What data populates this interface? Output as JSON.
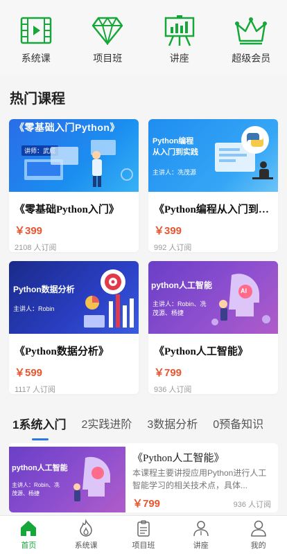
{
  "categories": [
    {
      "label": "系统课",
      "icon": "film-icon"
    },
    {
      "label": "项目班",
      "icon": "diamond-icon"
    },
    {
      "label": "讲座",
      "icon": "easel-icon"
    },
    {
      "label": "超级会员",
      "icon": "crown-icon"
    }
  ],
  "hot": {
    "title": "热门课程",
    "cards": [
      {
        "title": "《零基础Python入门》",
        "price": "￥399",
        "subs": "2108 人订阅",
        "thumb_title": "《零基础入门Python》",
        "thumb_sub": "讲师：武威"
      },
      {
        "title": "《Python编程从入门到实践》",
        "price": "￥399",
        "subs": "992 人订阅",
        "thumb_title": "Python编程\n从入门到实践",
        "thumb_sub": "主讲人：冼茂源"
      },
      {
        "title": "《Python数据分析》",
        "price": "￥599",
        "subs": "1117 人订阅",
        "thumb_title": "Python数据分析",
        "thumb_sub": "主讲人：Robin"
      },
      {
        "title": "《Python人工智能》",
        "price": "￥799",
        "subs": "936 人订阅",
        "thumb_title": "python人工智能",
        "thumb_sub": "主讲人：Robin、冼茂源、杨捷"
      }
    ]
  },
  "tabs": [
    "1系统入门",
    "2实践进阶",
    "3数据分析",
    "0预备知识"
  ],
  "list_item": {
    "title": "《Python人工智能》",
    "desc": "本课程主要讲授应用Python进行人工智能学习的相关技术点，具体...",
    "price": "￥799",
    "subs": "936 人订阅",
    "thumb_title": "python人工智能",
    "thumb_sub": "主讲人：Robin、冼茂源、杨捷"
  },
  "bottom_nav": [
    {
      "label": "首页",
      "icon": "home-icon"
    },
    {
      "label": "系统课",
      "icon": "flame-icon"
    },
    {
      "label": "项目班",
      "icon": "clipboard-icon"
    },
    {
      "label": "讲座",
      "icon": "lecturer-icon"
    },
    {
      "label": "我的",
      "icon": "user-icon"
    }
  ],
  "colors": {
    "green": "#17a639",
    "price": "#e8552f",
    "tab_indicator": "#2878e0"
  }
}
